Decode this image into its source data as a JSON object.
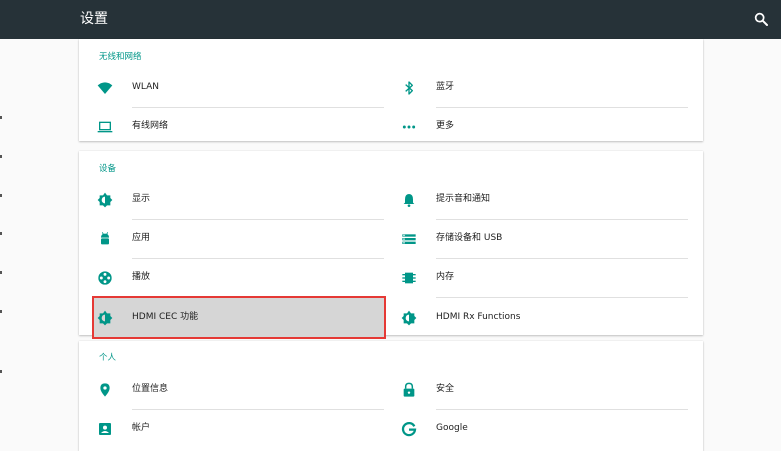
{
  "appbar": {
    "title": "设置",
    "search_icon": "search-icon"
  },
  "colors": {
    "appbar": "#263238",
    "accent": "#009688",
    "highlight_border": "#e53935"
  },
  "sections": [
    {
      "header": "无线和网络",
      "items": [
        {
          "label": "WLAN",
          "icon": "wifi-icon"
        },
        {
          "label": "蓝牙",
          "icon": "bluetooth-icon"
        },
        {
          "label": "有线网络",
          "icon": "laptop-icon"
        },
        {
          "label": "更多",
          "icon": "more-icon"
        }
      ]
    },
    {
      "header": "设备",
      "items": [
        {
          "label": "显示",
          "icon": "brightness-icon"
        },
        {
          "label": "提示音和通知",
          "icon": "bell-icon"
        },
        {
          "label": "应用",
          "icon": "android-icon"
        },
        {
          "label": "存储设备和 USB",
          "icon": "storage-icon"
        },
        {
          "label": "播放",
          "icon": "film-reel-icon"
        },
        {
          "label": "内存",
          "icon": "memory-chip-icon"
        },
        {
          "label": "HDMI CEC 功能",
          "icon": "brightness-icon",
          "highlighted": true
        },
        {
          "label": "HDMI Rx Functions",
          "icon": "brightness-icon"
        }
      ]
    },
    {
      "header": "个人",
      "items": [
        {
          "label": "位置信息",
          "icon": "location-icon"
        },
        {
          "label": "安全",
          "icon": "lock-icon"
        },
        {
          "label": "帐户",
          "icon": "account-box-icon"
        },
        {
          "label": "Google",
          "icon": "google-icon"
        }
      ]
    }
  ]
}
